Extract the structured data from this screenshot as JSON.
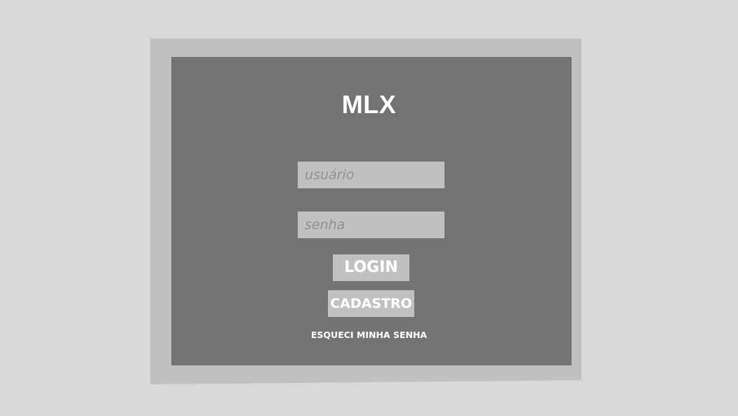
{
  "logo": {
    "text": "MLX"
  },
  "form": {
    "username_placeholder": "usuário",
    "username_value": "",
    "password_placeholder": "senha",
    "password_value": "",
    "login_label": "LOGIN",
    "register_label": "CADASTRO",
    "forgot_label": "ESQUECI MINHA SENHA"
  },
  "colors": {
    "background": "#d9d9d9",
    "outer_frame": "#c1c1c1",
    "inner_panel": "#737373",
    "text_light": "#ffffff",
    "placeholder": "#8f8f8f"
  }
}
